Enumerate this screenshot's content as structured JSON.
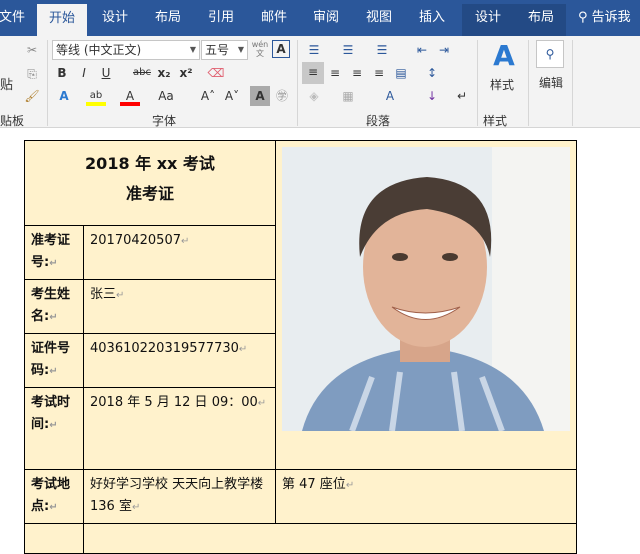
{
  "tabs": [
    "文件",
    "开始",
    "设计",
    "布局",
    "引用",
    "邮件",
    "审阅",
    "视图",
    "插入",
    "设计",
    "布局"
  ],
  "search_label": "告诉我",
  "ribbon": {
    "paste": "贴",
    "clipboard_group": "贴板",
    "font_name": "等线 (中文正文)",
    "font_size": "五号",
    "font_group": "字体",
    "paragraph_group": "段落",
    "styles_button": "样式",
    "styles_group": "样式",
    "edit_button": "编辑",
    "bold": "B",
    "italic": "I",
    "underline": "U",
    "strike": "abc",
    "sub": "x₂",
    "sup": "x²",
    "case": "Aa",
    "phonetic": "wén文"
  },
  "colors": {
    "highlight": "#ffff00",
    "font_color": "#ff0000",
    "ribbon_blue": "#2b579a",
    "table_bg": "#fff2cc"
  },
  "document": {
    "title": "2018 年 xx 考试",
    "subtitle": "准考证",
    "rows": [
      {
        "label": "准考证号:",
        "value": "20170420507"
      },
      {
        "label": "考生姓名:",
        "value": "张三"
      },
      {
        "label": "证件号码:",
        "value": "403610220319577730"
      },
      {
        "label": "考试时间:",
        "value": "2018 年 5 月 12 日  09：00"
      },
      {
        "label": "考试地点:",
        "value": "好好学习学校 天天向上教学楼 136 室",
        "seat": "第  47    座位"
      }
    ]
  }
}
